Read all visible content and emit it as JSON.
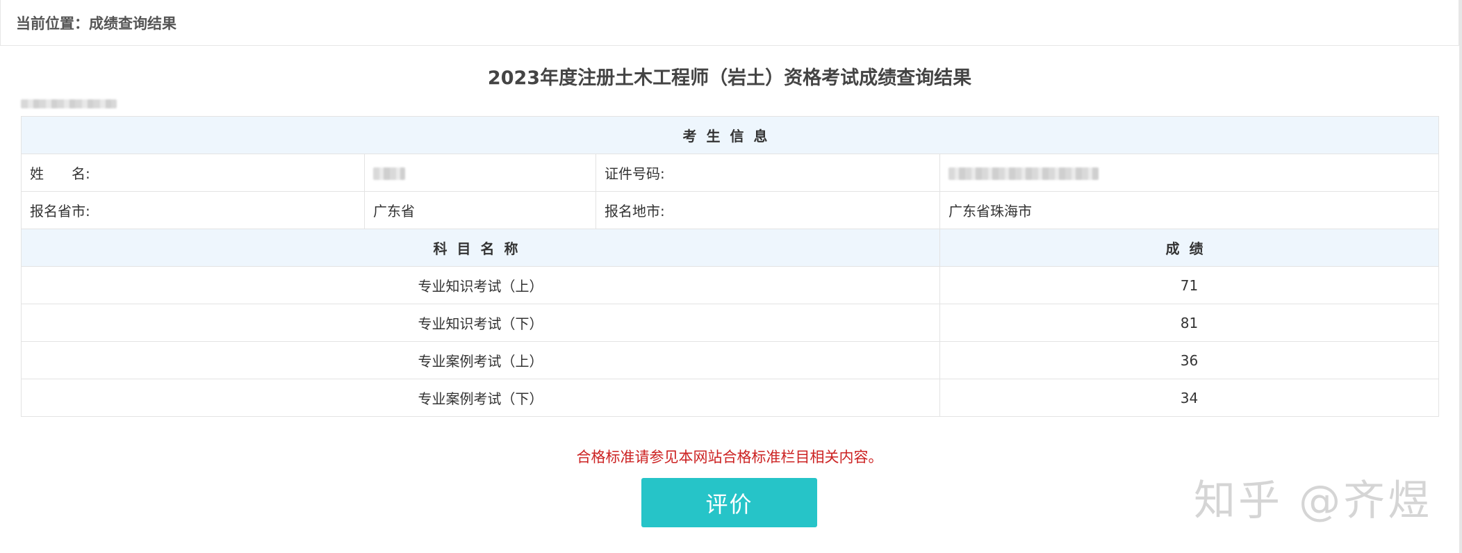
{
  "breadcrumb": {
    "text": "当前位置：成绩查询结果"
  },
  "page": {
    "title": "2023年度注册土木工程师（岩土）资格考试成绩查询结果"
  },
  "candidate": {
    "section_header": "考生信息",
    "name_label": "姓　　名:",
    "id_label": "证件号码:",
    "province_label": "报名省市:",
    "province_value": "广东省",
    "location_label": "报名地市:",
    "location_value": "广东省珠海市"
  },
  "scores": {
    "subject_header": "科目名称",
    "score_header": "成绩",
    "rows": [
      {
        "subject": "专业知识考试（上）",
        "score": "71"
      },
      {
        "subject": "专业知识考试（下）",
        "score": "81"
      },
      {
        "subject": "专业案例考试（上）",
        "score": "36"
      },
      {
        "subject": "专业案例考试（下）",
        "score": "34"
      }
    ]
  },
  "notice": {
    "text": "合格标准请参见本网站合格标准栏目相关内容。"
  },
  "actions": {
    "evaluate_label": "评价"
  },
  "watermark": {
    "text": "知乎 @齐煜"
  },
  "colors": {
    "header_bg": "#eef6fd",
    "notice_red": "#cc2222",
    "button_teal": "#26c4c8"
  }
}
